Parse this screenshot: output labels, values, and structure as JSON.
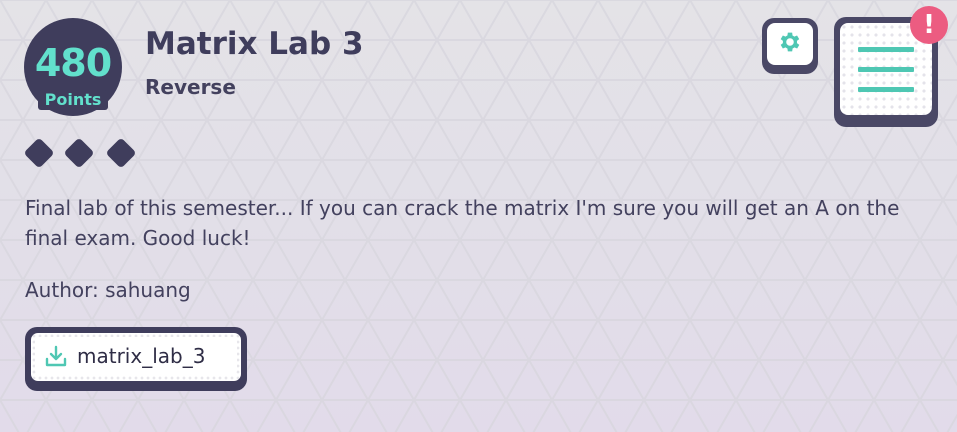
{
  "challenge": {
    "points": "480",
    "points_label": "Points",
    "title": "Matrix Lab 3",
    "category": "Reverse",
    "difficulty_level": 3,
    "description": "Final lab of this semester... If you can crack the matrix I'm sure you will get an A on the final exam. Good luck!",
    "author_text": "Author: sahuang",
    "attachment": {
      "filename": "matrix_lab_3",
      "icon": "download-icon"
    }
  },
  "toolbar": {
    "settings_icon": "gear-icon",
    "menu_icon": "list-icon",
    "alert_icon": "exclamation-icon",
    "alert_text": "!"
  },
  "colors": {
    "primary_dark": "#3f3d5c",
    "accent_teal": "#62e0cc",
    "menu_teal": "#4fc7b3",
    "alert_pink": "#ec5c81",
    "background": "#e3e1e8"
  }
}
